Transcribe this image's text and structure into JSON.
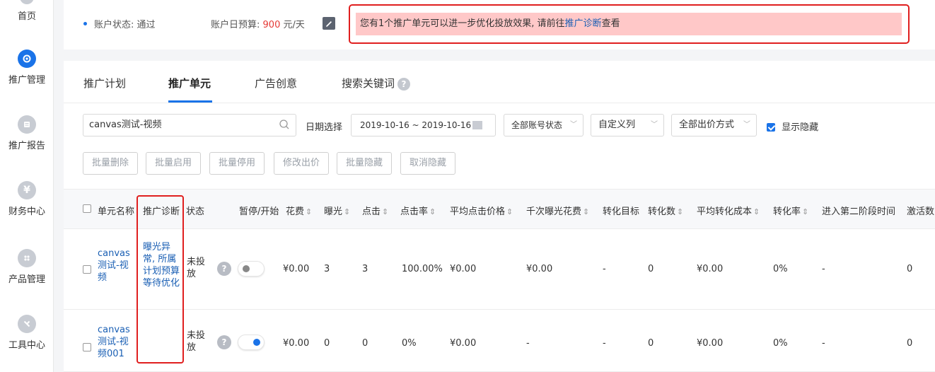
{
  "sidebar": {
    "items": [
      {
        "label": "首页",
        "icon": "home-icon"
      },
      {
        "label": "推广管理",
        "icon": "promotion-icon",
        "active": true
      },
      {
        "label": "推广报告",
        "icon": "report-icon"
      },
      {
        "label": "财务中心",
        "icon": "yen-icon",
        "glyph": "¥"
      },
      {
        "label": "产品管理",
        "icon": "product-icon"
      },
      {
        "label": "工具中心",
        "icon": "tools-icon"
      }
    ]
  },
  "status_bar": {
    "account_status_label": "账户状态:",
    "account_status_value": "通过",
    "daily_budget_label": "账户日预算:",
    "daily_budget_value": "900",
    "daily_budget_unit": "元/天",
    "alert_prefix": "您有1个推广单元可以进一步优化投放效果, 请前往",
    "alert_link": "推广诊断",
    "alert_suffix": "查看"
  },
  "tabs": [
    {
      "label": "推广计划"
    },
    {
      "label": "推广单元",
      "active": true
    },
    {
      "label": "广告创意"
    },
    {
      "label": "搜索关键词"
    }
  ],
  "filters": {
    "search_value": "canvas测试-视频",
    "date_label": "日期选择",
    "date_range": "2019-10-16 ~ 2019-10-16",
    "account_status_select": "全部账号状态",
    "custom_columns_select": "自定义列",
    "bid_method_select": "全部出价方式",
    "show_hidden_label": "显示隐藏"
  },
  "batch_actions": [
    "批量删除",
    "批量启用",
    "批量停用",
    "修改出价",
    "批量隐藏",
    "取消隐藏"
  ],
  "table": {
    "columns": [
      "单元名称",
      "推广诊断",
      "状态",
      "暂停/开始",
      "花费",
      "曝光",
      "点击",
      "点击率",
      "平均点击价格",
      "千次曝光花费",
      "转化目标",
      "转化数",
      "平均转化成本",
      "转化率",
      "进入第二阶段时间",
      "激活数"
    ],
    "rows": [
      {
        "name_lines": [
          "canvas",
          "测试-视",
          "频"
        ],
        "diagnosis_lines": [
          "曝光异",
          "常, 所属",
          "计划预算",
          "等待优化"
        ],
        "status_lines": [
          "未投",
          "放"
        ],
        "switch_on": false,
        "cost": "¥0.00",
        "impressions": "3",
        "clicks": "3",
        "ctr": "100.00%",
        "avg_click_price": "¥0.00",
        "cpm": "¥0.00",
        "conversion_target": "-",
        "conversions": "0",
        "avg_conversion_cost": "¥0.00",
        "conversion_rate": "0%",
        "phase2_time": "-",
        "activations": "0"
      },
      {
        "name_lines": [
          "canvas",
          "测试-视",
          "频001"
        ],
        "diagnosis_lines": [],
        "status_lines": [
          "未投",
          "放"
        ],
        "switch_on": true,
        "cost": "¥0.00",
        "impressions": "0",
        "clicks": "0",
        "ctr": "0%",
        "avg_click_price": "¥0.00",
        "cpm": "-",
        "conversion_target": "-",
        "conversions": "0",
        "avg_conversion_cost": "¥0.00",
        "conversion_rate": "0%",
        "phase2_time": "-",
        "activations": "0"
      }
    ]
  },
  "colors": {
    "accent": "#1a73e8",
    "alert_border": "#e01f1f",
    "alert_bg": "#ffc8c8",
    "budget": "#e53935",
    "link": "#1a5fb4"
  }
}
